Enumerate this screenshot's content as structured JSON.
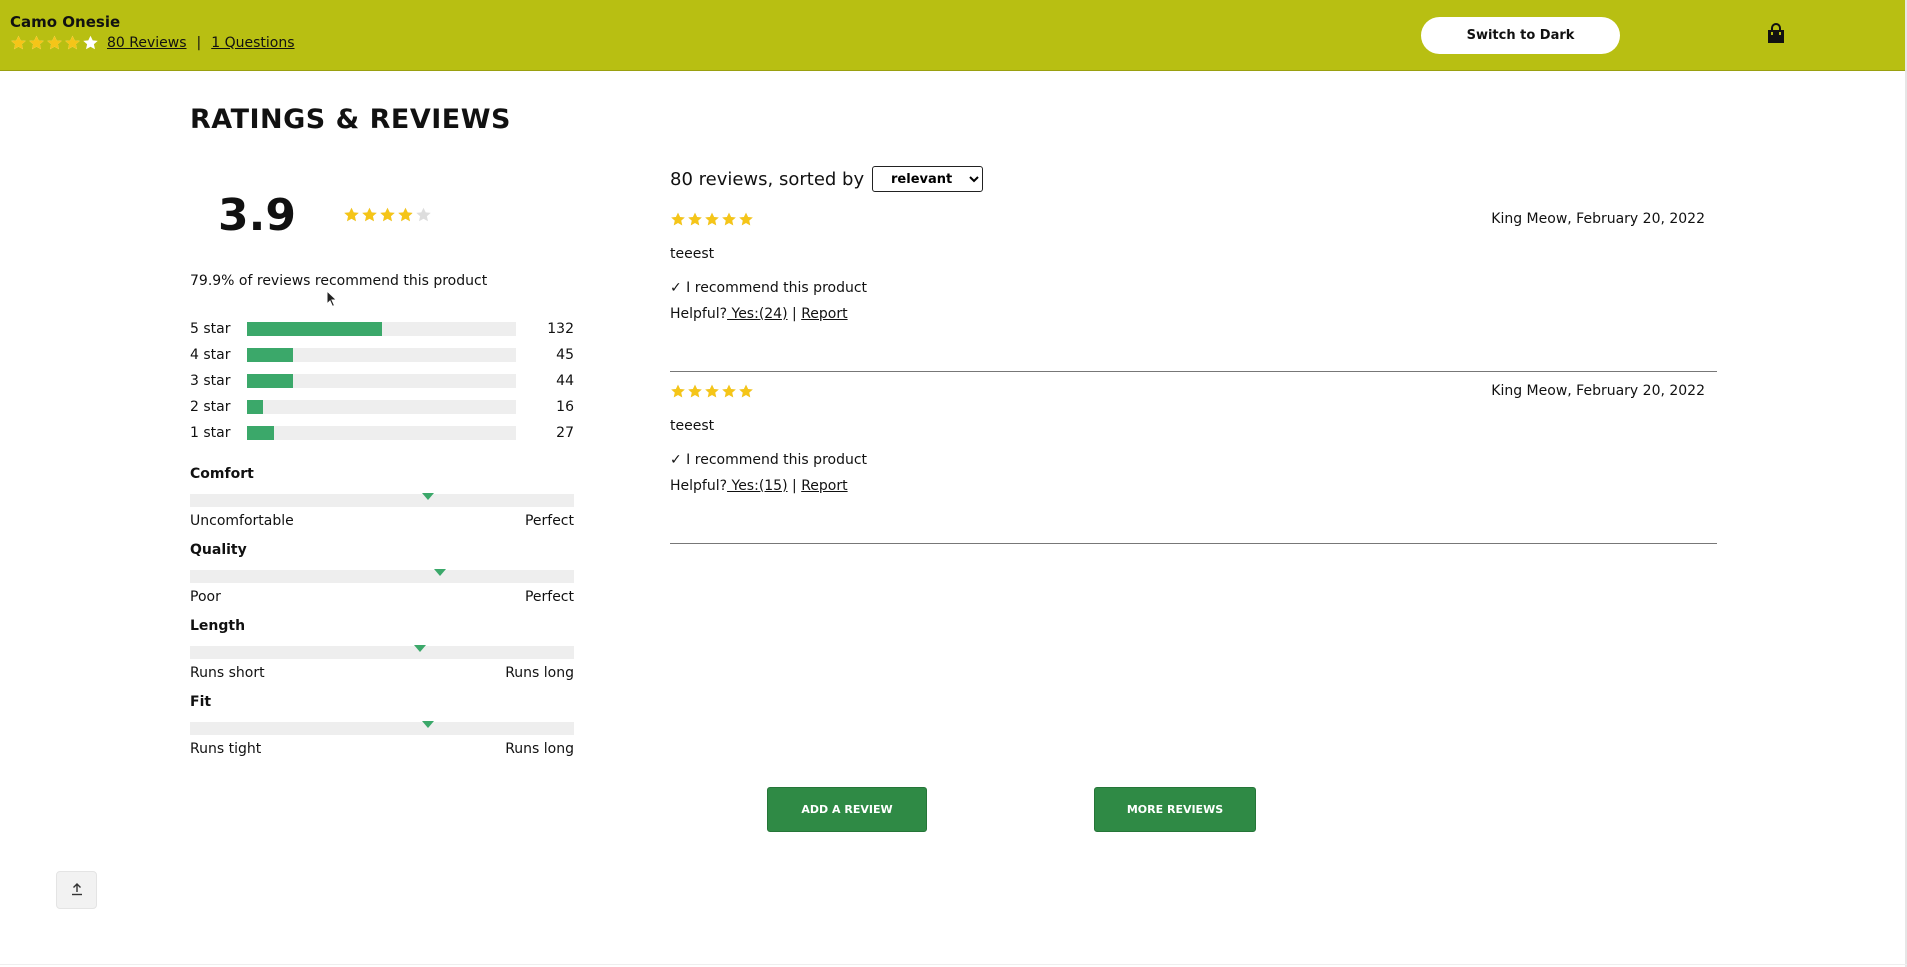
{
  "header": {
    "product_name": "Camo Onesie",
    "rating": 3.9,
    "reviews_link": "80 Reviews",
    "separator": "|",
    "questions_link": "1 Questions",
    "theme_toggle": "Switch to Dark",
    "cart_icon": "shopping-bag-icon"
  },
  "section_title": "RATINGS & REVIEWS",
  "summary": {
    "average": "3.9",
    "average_value": 3.9,
    "recommend_text": "79.9% of reviews recommend this product",
    "breakdown": [
      {
        "label": "5 star",
        "count": "132",
        "fraction": 0.5
      },
      {
        "label": "4 star",
        "count": "45",
        "fraction": 0.17
      },
      {
        "label": "3 star",
        "count": "44",
        "fraction": 0.17
      },
      {
        "label": "2 star",
        "count": "16",
        "fraction": 0.06
      },
      {
        "label": "1 star",
        "count": "27",
        "fraction": 0.1
      }
    ]
  },
  "characteristics": [
    {
      "name": "Comfort",
      "low": "Uncomfortable",
      "high": "Perfect",
      "value": 0.62
    },
    {
      "name": "Quality",
      "low": "Poor",
      "high": "Perfect",
      "value": 0.65
    },
    {
      "name": "Length",
      "low": "Runs short",
      "high": "Runs long",
      "value": 0.6
    },
    {
      "name": "Fit",
      "low": "Runs tight",
      "high": "Runs long",
      "value": 0.62
    }
  ],
  "review_list": {
    "count_text": "80 reviews, sorted by",
    "sort_selected": "relevant",
    "reviews": [
      {
        "rating": 5,
        "meta": "King Meow, February 20, 2022",
        "body": "teeest",
        "recommend": "✓ I recommend this product",
        "helpful_label": "Helpful?",
        "yes_link": " Yes:(24)",
        "divider": "|",
        "report": "Report"
      },
      {
        "rating": 5,
        "meta": "King Meow, February 20, 2022",
        "body": "teeest",
        "recommend": "✓ I recommend this product",
        "helpful_label": "Helpful?",
        "yes_link": " Yes:(15)",
        "divider": "|",
        "report": "Report"
      }
    ]
  },
  "actions": {
    "add_review": "ADD A REVIEW",
    "more_reviews": "MORE REVIEWS"
  },
  "colors": {
    "header_bg": "#b8bf12",
    "star_filled": "#f5c518",
    "star_empty": "#dddddd",
    "bar_fill": "#3ba86a",
    "button_green": "#2f8a45"
  }
}
